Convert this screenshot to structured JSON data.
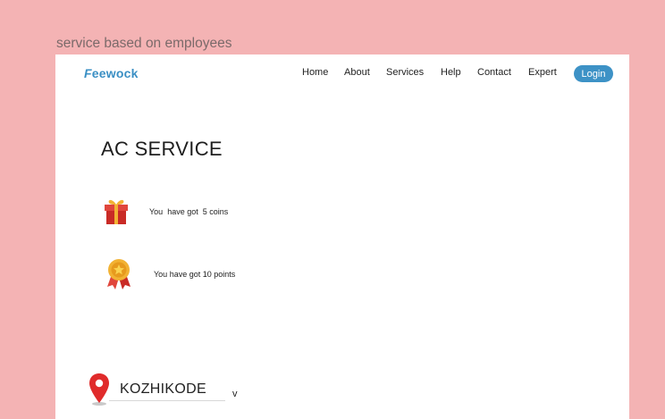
{
  "frame_label": "service based on employees",
  "header": {
    "logo_text": "eewock",
    "logo_f": "F",
    "nav": [
      "Home",
      "About",
      "Services",
      "Help",
      "Contact",
      "Expert"
    ],
    "login_label": "Login"
  },
  "main": {
    "title": "AC SERVICE",
    "coins_text": "You  have got  5 coins",
    "points_text": "You have got 10 points",
    "location": {
      "value": "KOZHIKODE",
      "chevron": "v"
    }
  },
  "icons": {
    "gift": "gift-icon",
    "medal": "medal-icon",
    "location": "location-pin-icon"
  },
  "colors": {
    "background": "#f4b3b4",
    "brand": "#3a8fc4",
    "login_button": "#3d92c6",
    "pin": "#e02b2b",
    "gift": "#d9322c",
    "medal": "#f2b233"
  }
}
